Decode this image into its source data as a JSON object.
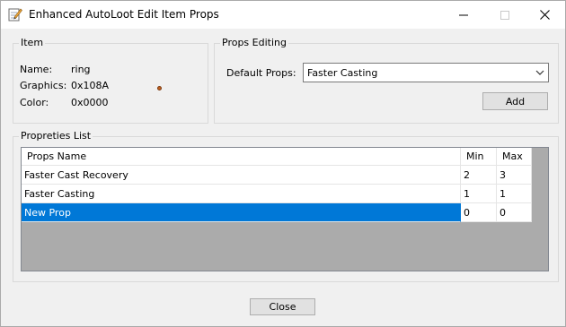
{
  "window": {
    "title": "Enhanced AutoLoot Edit Item Props"
  },
  "item_group": {
    "legend": "Item",
    "name_label": "Name:",
    "name_value": "ring",
    "graphics_label": "Graphics:",
    "graphics_value": "0x108A",
    "color_label": "Color:",
    "color_value": "0x0000"
  },
  "props_editing": {
    "legend": "Props Editing",
    "default_label": "Default Props:",
    "default_value": "Faster Casting",
    "add_label": "Add"
  },
  "props_list": {
    "legend": "Propreties List",
    "columns": [
      "Props Name",
      "Min",
      "Max"
    ],
    "rows": [
      {
        "name": "Faster Cast Recovery",
        "min": "2",
        "max": "3",
        "selected": false
      },
      {
        "name": "Faster Casting",
        "min": "1",
        "max": "1",
        "selected": false
      },
      {
        "name": "New Prop",
        "min": "0",
        "max": "0",
        "selected": true
      }
    ]
  },
  "footer": {
    "close_label": "Close"
  },
  "colors": {
    "selection": "#0078d7",
    "list_empty_bg": "#ababab",
    "window_bg": "#f0f0f0"
  },
  "icons": [
    "notepad-edit-icon",
    "minimize-icon",
    "maximize-icon",
    "close-icon",
    "chevron-down-icon",
    "color-swatch-dot"
  ]
}
